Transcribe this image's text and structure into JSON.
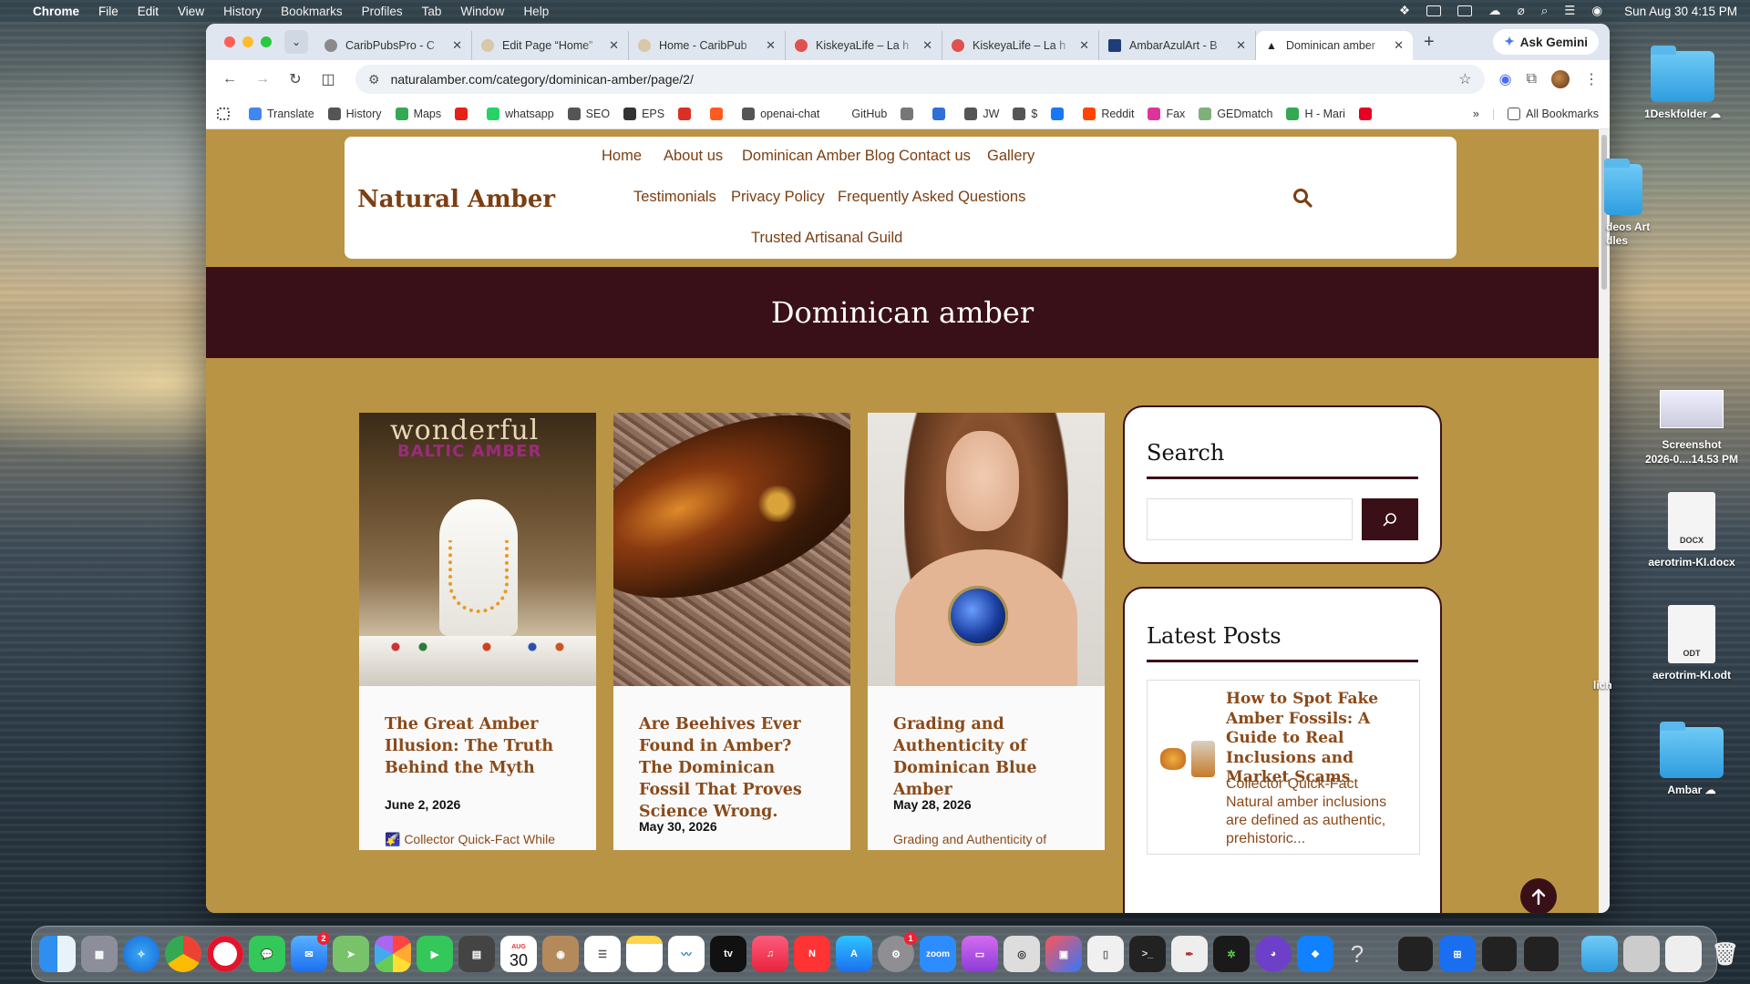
{
  "menubar": {
    "app": "Chrome",
    "items": [
      "File",
      "Edit",
      "View",
      "History",
      "Bookmarks",
      "Profiles",
      "Tab",
      "Window",
      "Help"
    ],
    "clock": "Sun Aug 30  4:15 PM"
  },
  "tabs": [
    {
      "title": "CaribPubsPro - C",
      "color": "#8a8a8a"
    },
    {
      "title": "Edit Page “Home”",
      "color": "#d8c7a8"
    },
    {
      "title": "Home - CaribPub",
      "color": "#d8c7a8"
    },
    {
      "title": "KiskeyaLife – La h",
      "color": "#e05050"
    },
    {
      "title": "KiskeyaLife – La h",
      "color": "#e05050"
    },
    {
      "title": "AmbarAzulArt - B",
      "color": "#1d3c78"
    },
    {
      "title": "Dominican amber",
      "color": "#222222",
      "active": true
    }
  ],
  "gemini_label": "Ask Gemini",
  "url": "naturalamber.com/category/dominican-amber/page/2/",
  "bookmarks": [
    {
      "label": "",
      "icon": "apps-grid-icon"
    },
    {
      "label": "Translate",
      "color": "#4285f4"
    },
    {
      "label": "History",
      "color": "#555"
    },
    {
      "label": "Maps",
      "color": "#34a853"
    },
    {
      "label": "",
      "color": "#e62117"
    },
    {
      "label": "whatsapp",
      "color": "#25d366"
    },
    {
      "label": "SEO",
      "color": "#555"
    },
    {
      "label": "EPS",
      "color": "#333"
    },
    {
      "label": "",
      "color": "#d93025"
    },
    {
      "label": "",
      "color": "#ff5a1f"
    },
    {
      "label": "openai-chat",
      "color": "#555"
    },
    {
      "label": "GitHub",
      "color": "#ffffff"
    },
    {
      "label": "",
      "color": "#777"
    },
    {
      "label": "",
      "color": "#2f6fd8"
    },
    {
      "label": "JW",
      "color": "#555"
    },
    {
      "label": "$",
      "color": "#555"
    },
    {
      "label": "",
      "color": "#1877f2"
    },
    {
      "label": "Reddit",
      "color": "#ff4500"
    },
    {
      "label": "Fax",
      "color": "#e0339a"
    },
    {
      "label": "GEDmatch",
      "color": "#7fb07a"
    },
    {
      "label": "H - Mari",
      "color": "#34a853"
    },
    {
      "label": "",
      "color": "#e60023"
    }
  ],
  "all_bookmarks": "All Bookmarks",
  "site": {
    "logo": "Natural Amber",
    "nav_row1": [
      "Home",
      "About us",
      "Dominican Amber Blog",
      "Contact us",
      "Gallery"
    ],
    "nav_row2": [
      "Testimonials",
      "Privacy Policy",
      "Frequently Asked Questions"
    ],
    "nav_row3": [
      "Trusted Artisanal Guild"
    ],
    "page_title": "Dominican amber",
    "posts": [
      {
        "title": "The Great Amber Illusion: The Truth Behind the Myth",
        "date": "June 2, 2026",
        "excerpt": "🌠 Collector Quick-Fact While",
        "image_text_1": "wonderful",
        "image_text_2": "BALTIC AMBER"
      },
      {
        "title": "Are Beehives Ever Found in Amber? The Dominican Fossil That Proves Science Wrong.",
        "date": "May 30, 2026",
        "excerpt": ""
      },
      {
        "title": "Grading and Authenticity of Dominican Blue Amber",
        "date": "May 28, 2026",
        "excerpt": "Grading and Authenticity of"
      }
    ],
    "search_widget_title": "Search",
    "latest_posts_title": "Latest Posts",
    "latest_post": {
      "title": "How to Spot Fake Amber Fossils: A Guide to Real Inclusions and Market Scams",
      "excerpt": "Collector Quick-Fact Natural amber inclusions are defined as authentic, prehistoric..."
    }
  },
  "desktop_icons": [
    {
      "label": "1Deskfolder",
      "type": "folder"
    },
    {
      "label": "deos Art\ndles",
      "type": "folder"
    },
    {
      "label": "Screenshot\n2026-0....14.53 PM",
      "type": "screenshot"
    },
    {
      "label": "aerotrim-KI.docx",
      "type": "doc",
      "badge": "DOCX"
    },
    {
      "label": "aerotrim-KI.odt",
      "type": "doc",
      "badge": "ODT"
    },
    {
      "label": "lich",
      "type": "partial"
    },
    {
      "label": "Ambar",
      "type": "folder"
    }
  ],
  "dock": {
    "calendar_month": "AUG",
    "calendar_day": "30",
    "mail_badge": "2",
    "settings_badge": "1",
    "tv_label": "tv",
    "zoom_label": "zoom"
  }
}
